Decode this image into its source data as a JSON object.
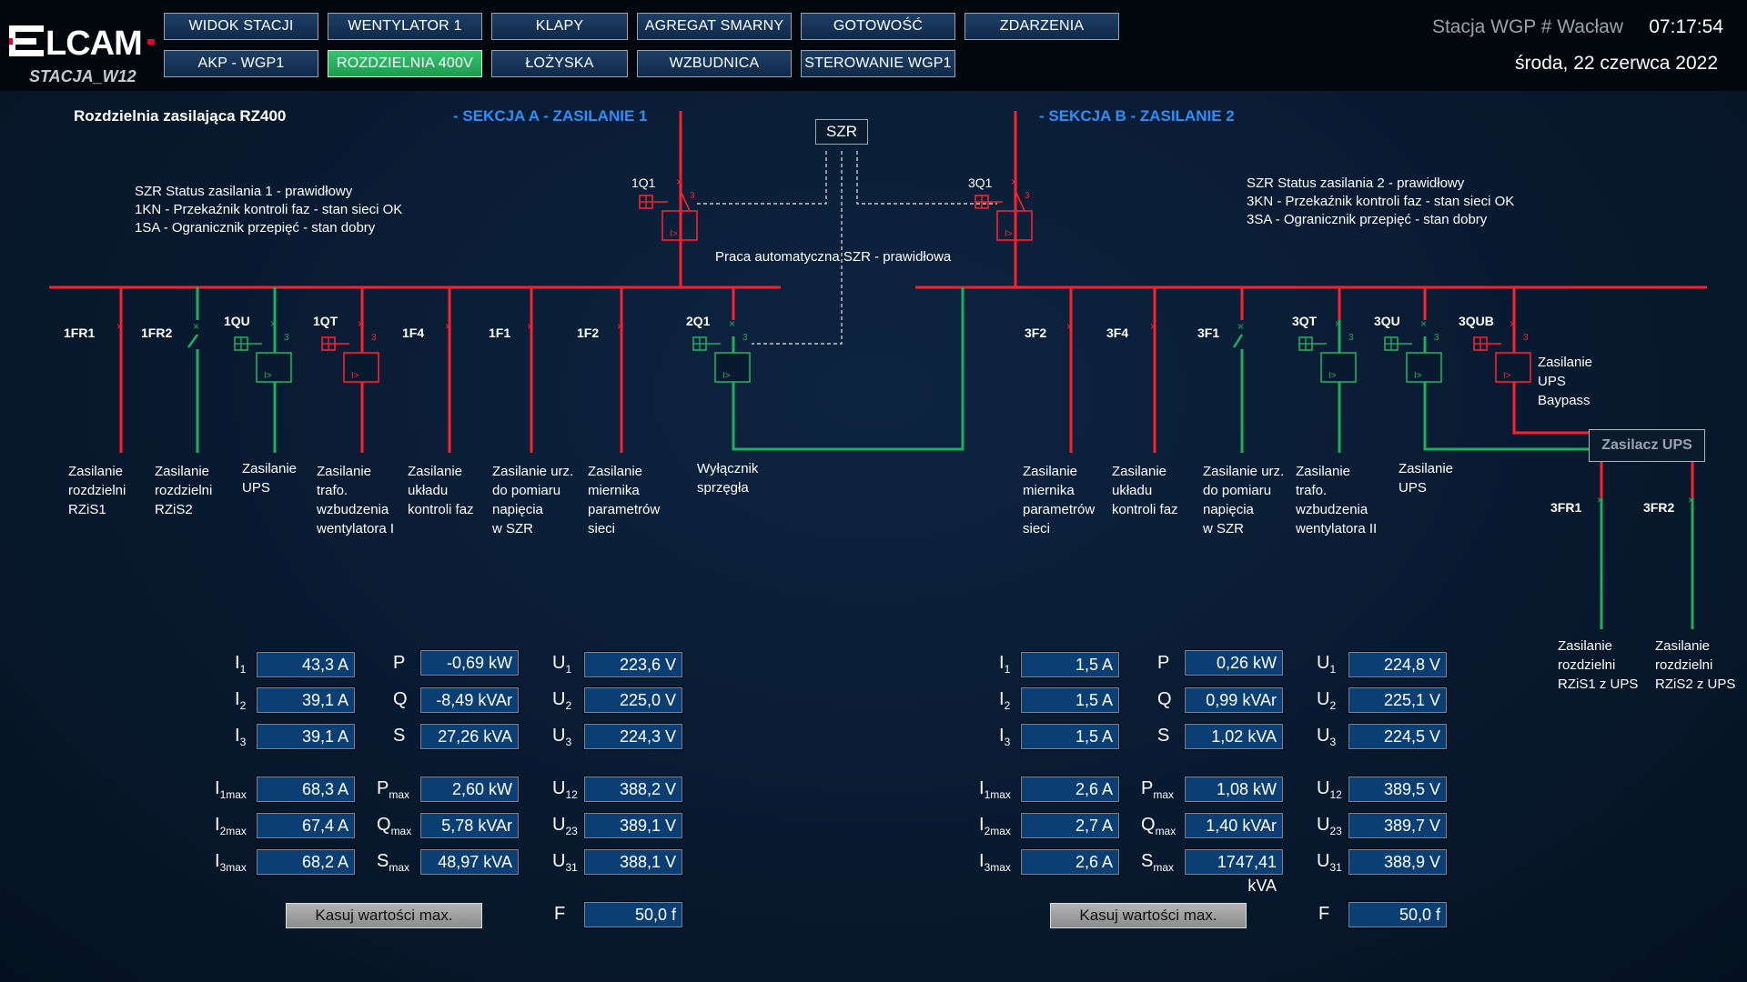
{
  "header": {
    "brand": "ELCAM",
    "station_code": "STACJA_W12",
    "station_name": "Stacja WGP # Wacław",
    "time": "07:17:54",
    "date": "środa, 22 czerwca 2022"
  },
  "nav": {
    "row1": [
      "WIDOK STACJI",
      "WENTYLATOR 1",
      "KLAPY",
      "AGREGAT SMARNY",
      "GOTOWOŚĆ",
      "ZDARZENIA"
    ],
    "row2": [
      "AKP - WGP1",
      "ROZDZIELNIA 400V",
      "ŁOŻYSKA",
      "WZBUDNICA",
      "STEROWANIE WGP1"
    ],
    "active": "ROZDZIELNIA 400V"
  },
  "diagram": {
    "title": "Rozdzielnia zasilająca RZ400",
    "section_a": "- SEKCJA A  - ZASILANIE 1",
    "section_b": "- SEKCJA B  - ZASILANIE 2",
    "szr": "SZR",
    "auto_status": "Praca automatyczna SZR - prawidłowa",
    "status_a": [
      "SZR Status zasilania 1 - prawidłowy",
      "1KN - Przekaźnik kontroli faz - stan sieci OK",
      "1SA - Ogranicznik przepięć - stan dobry"
    ],
    "status_b": [
      "SZR Status zasilania 2 - prawidłowy",
      "3KN - Przekaźnik kontroli faz - stan sieci OK",
      "3SA - Ogranicznik przepięć - stan dobry"
    ],
    "breaker_1q1": "1Q1",
    "breaker_3q1": "3Q1",
    "breaker_2q1": "2Q1",
    "ups_box": "Zasilacz UPS",
    "ups_bypass": "Zasilanie\nUPS\nBaypass",
    "feeders_a": [
      {
        "label": "1FR1",
        "caption": "Zasilanie\nrozdzielni\nRZiS1"
      },
      {
        "label": "1FR2",
        "caption": "Zasilanie\nrozdzielni\nRZiS2"
      },
      {
        "label": "1QU",
        "caption": "Zasilanie\nUPS"
      },
      {
        "label": "1QT",
        "caption": "Zasilanie\ntrafo.\nwzbudzenia\nwentylatora I"
      },
      {
        "label": "1F4",
        "caption": "Zasilanie\nukładu\nkontroli faz"
      },
      {
        "label": "1F1",
        "caption": "Zasilanie urz.\ndo pomiaru\nnapięcia\nw SZR"
      },
      {
        "label": "1F2",
        "caption": "Zasilanie\nmiernika\nparametrów\nsieci"
      }
    ],
    "coupler_caption": "Wyłącznik\nsprzęgła",
    "feeders_b": [
      {
        "label": "3F2",
        "caption": "Zasilanie\nmiernika\nparametrów\nsieci"
      },
      {
        "label": "3F4",
        "caption": "Zasilanie\nukładu\nkontroli faz"
      },
      {
        "label": "3F1",
        "caption": "Zasilanie urz.\ndo pomiaru\nnapięcia\nw SZR"
      },
      {
        "label": "3QT",
        "caption": "Zasilanie\ntrafo.\nwzbudzenia\nwentylatora II"
      },
      {
        "label": "3QU",
        "caption": "Zasilanie\nUPS"
      },
      {
        "label": "3QUB",
        "caption": ""
      }
    ],
    "ups_feeders": [
      {
        "label": "3FR1",
        "caption": "Zasilanie\nrozdzielni\nRZiS1 z UPS"
      },
      {
        "label": "3FR2",
        "caption": "Zasilanie\nrozdzielni\nRZiS2 z UPS"
      }
    ],
    "colors": {
      "energized": "#ff1f2d",
      "deenergized": "#1fae5b",
      "section": "#2a8fff"
    }
  },
  "measurements_a": {
    "I1": "43,3 A",
    "I2": "39,1 A",
    "I3": "39,1 A",
    "P": "-0,69 kW",
    "Q": "-8,49 kVAr",
    "S": "27,26 kVA",
    "U1": "223,6 V",
    "U2": "225,0 V",
    "U3": "224,3 V",
    "I1max": "68,3 A",
    "I2max": "67,4 A",
    "I3max": "68,2 A",
    "Pmax": "2,60 kW",
    "Qmax": "5,78 kVAr",
    "Smax": "48,97 kVA",
    "U12": "388,2 V",
    "U23": "389,1 V",
    "U31": "388,1 V",
    "F": "50,0 f",
    "reset": "Kasuj wartości max."
  },
  "measurements_b": {
    "I1": "1,5 A",
    "I2": "1,5 A",
    "I3": "1,5 A",
    "P": "0,26 kW",
    "Q": "0,99 kVAr",
    "S": "1,02 kVA",
    "U1": "224,8 V",
    "U2": "225,1 V",
    "U3": "224,5 V",
    "I1max": "2,6 A",
    "I2max": "2,7 A",
    "I3max": "2,6 A",
    "Pmax": "1,08 kW",
    "Qmax": "1,40 kVAr",
    "Smax": "1747,41 kVA",
    "U12": "389,5 V",
    "U23": "389,7 V",
    "U31": "388,9 V",
    "F": "50,0 f",
    "reset": "Kasuj wartości max."
  }
}
